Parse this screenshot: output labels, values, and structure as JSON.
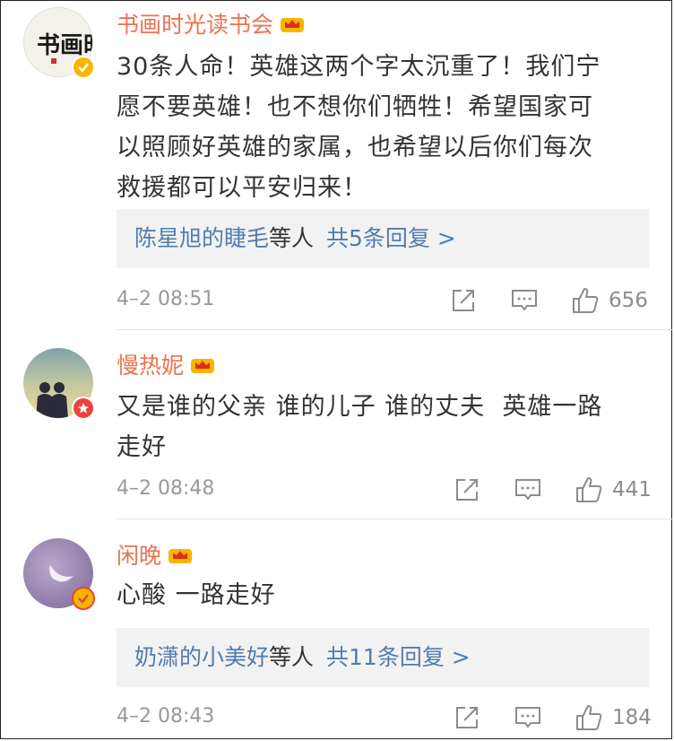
{
  "comments": [
    {
      "username": "书画时光读书会",
      "avatar_text": "书画时光",
      "badge": "verified-yellow",
      "lines": [
        "30条人命！英雄这两个字太沉重了！我们宁",
        "愿不要英雄！也不想你们牺牲！希望国家可",
        "以照顾好英雄的家属，也希望以后你们每次",
        "救援都可以平安归来！"
      ],
      "reply_name": "陈星旭的睫毛",
      "reply_mid": "等人",
      "reply_count": "共5条回复 >",
      "time": "4–2 08:51",
      "likes": "656"
    },
    {
      "username": "慢热妮",
      "badge": "red-star",
      "lines": [
        "又是谁的父亲 谁的儿子 谁的丈夫  英雄一路",
        "走好"
      ],
      "time": "4–2 08:48",
      "likes": "441"
    },
    {
      "username": "闲晚",
      "badge": "verified-yellow",
      "lines": [
        "心酸 一路走好"
      ],
      "reply_name": "奶潇的小美好",
      "reply_mid": "等人",
      "reply_count": "共11条回复 >",
      "time": "4–2 08:43",
      "likes": "184"
    }
  ],
  "colors": {
    "username": "#eb7350",
    "link": "#507daf",
    "meta": "#999999",
    "badge_yellow": "#f7b500",
    "badge_red": "#e8453c"
  }
}
